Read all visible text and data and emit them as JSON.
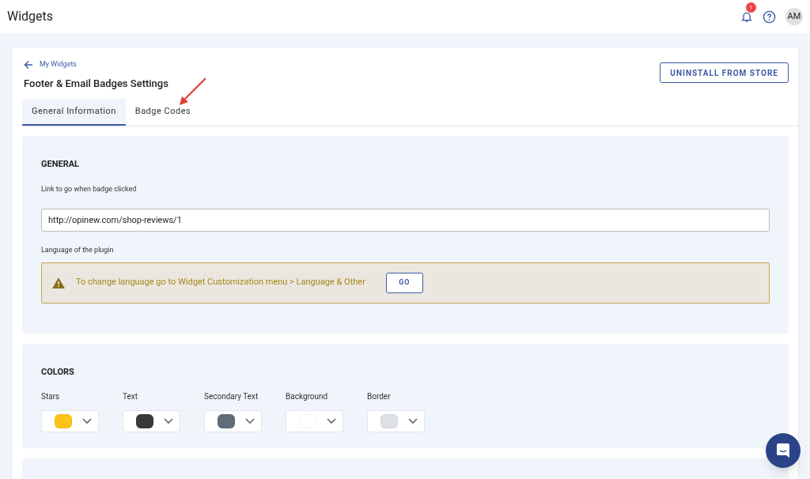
{
  "app_bar": {
    "title": "Widgets",
    "notification_count": "1",
    "avatar": "AM"
  },
  "header": {
    "back_link": "My Widgets",
    "title": "Footer & Email Badges Settings",
    "action_button": "UNINSTALL FROM STORE"
  },
  "tabs": [
    {
      "label": "General Information",
      "selected": true
    },
    {
      "label": "Badge Codes",
      "selected": false
    }
  ],
  "general": {
    "heading": "GENERAL",
    "link_label": "Link to go when badge clicked",
    "link_value": "http://opinew.com/shop-reviews/1",
    "language_label": "Language of the plugin",
    "warning": "To change language go to Widget Customization menu > Language & Other",
    "warning_button": "GO"
  },
  "colors": {
    "heading": "COLORS",
    "items": [
      {
        "label": "Stars",
        "color": "#fcc419"
      },
      {
        "label": "Text",
        "color": "#393939"
      },
      {
        "label": "Secondary Text",
        "color": "#5f6d7a"
      },
      {
        "label": "Background",
        "color": "#ffffff"
      },
      {
        "label": "Border",
        "color": "#dde1e7"
      }
    ]
  }
}
